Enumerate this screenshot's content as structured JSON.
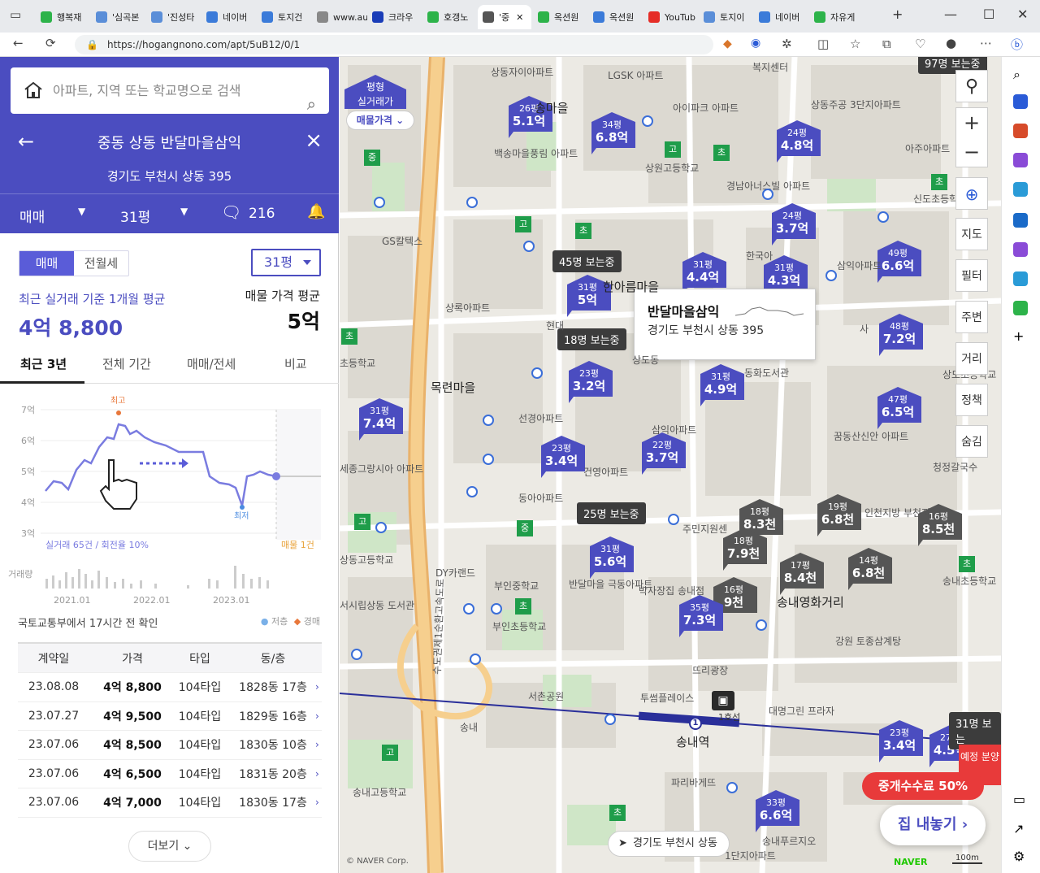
{
  "browser": {
    "tabs": [
      {
        "label": "행복재",
        "color": "#2db34a"
      },
      {
        "label": "'심곡본",
        "color": "#5a8ed8"
      },
      {
        "label": "'진성타",
        "color": "#5a8ed8"
      },
      {
        "label": "네이버",
        "color": "#3b7bd9"
      },
      {
        "label": "토지건",
        "color": "#3b7bd9"
      },
      {
        "label": "www.au",
        "color": "#888888"
      },
      {
        "label": "크라우",
        "color": "#1a3db8"
      },
      {
        "label": "호갱노",
        "color": "#2db34a"
      },
      {
        "label": "'중",
        "color": "#555555"
      },
      {
        "label": "옥션원",
        "color": "#2db34a"
      },
      {
        "label": "옥션원",
        "color": "#3b7bd9"
      },
      {
        "label": "YouTub",
        "color": "#e52d27"
      },
      {
        "label": "토지이",
        "color": "#5a8ed8"
      },
      {
        "label": "네이버",
        "color": "#3b7bd9"
      },
      {
        "label": "자유게",
        "color": "#2db34a"
      }
    ],
    "url": "https://hogangnono.com/apt/5uB12/0/1"
  },
  "panel": {
    "search_placeholder": "아파트, 지역 또는 학교명으로 검색",
    "title": "중동 상동 반달마을삼익",
    "address": "경기도 부천시 상동 395",
    "trade_type": "매매",
    "pyeong": "31평",
    "comments": "216",
    "trade_tab_sale": "매매",
    "trade_tab_rent": "전월세",
    "pyeong_select": "31평",
    "avg_label": "최근 실거래 기준 1개월 평균",
    "avg_value": "4억 8,800",
    "market_label": "매물 가격 평균",
    "market_value": "5억",
    "period_tabs": [
      "최근 3년",
      "전체 기간",
      "매매/전세",
      "비교"
    ],
    "chart": {
      "y_labels": [
        "7억",
        "6억",
        "5억",
        "4억",
        "3억"
      ],
      "high_label": "최고",
      "low_label": "최저",
      "stats": "실거래 65건 / 회전율 10%",
      "listing": "매물 1건",
      "volume_label": "거래량",
      "x_labels": [
        "2021.01",
        "2022.01",
        "2023.01"
      ]
    },
    "confirm_text": "국토교통부에서 17시간 전 확인",
    "legend_low": "저층",
    "legend_high": "경매",
    "table_headers": [
      "계약일",
      "가격",
      "타입",
      "동/층"
    ],
    "rows": [
      {
        "date": "23.08.08",
        "price": "4억 8,800",
        "type": "104타입",
        "floor": "1828동 17층"
      },
      {
        "date": "23.07.27",
        "price": "4억 9,500",
        "type": "104타입",
        "floor": "1829동 16층"
      },
      {
        "date": "23.07.06",
        "price": "4억 8,500",
        "type": "104타입",
        "floor": "1830동 10층"
      },
      {
        "date": "23.07.06",
        "price": "4억 6,500",
        "type": "104타입",
        "floor": "1831동 20층"
      },
      {
        "date": "23.07.06",
        "price": "4억 7,000",
        "type": "104타입",
        "floor": "1830동 17층"
      }
    ],
    "more": "더보기"
  },
  "map": {
    "filter_top": "평형",
    "filter_mid": "실거래가",
    "filter_btn": "매물가격",
    "markers": [
      {
        "p": "26평",
        "v": "5.1억",
        "color": "#4b4dc0"
      },
      {
        "p": "34평",
        "v": "6.8억",
        "color": "#4b4dc0"
      },
      {
        "p": "24평",
        "v": "4.8억",
        "color": "#4b4dc0"
      },
      {
        "p": "24평",
        "v": "3.7억",
        "color": "#4b4dc0"
      },
      {
        "p": "31평",
        "v": "4.4억",
        "color": "#4b4dc0"
      },
      {
        "p": "31평",
        "v": "4.3억",
        "color": "#4b4dc0"
      },
      {
        "p": "49평",
        "v": "6.6억",
        "color": "#4b4dc0"
      },
      {
        "p": "31평",
        "v": "5억",
        "color": "#4b4dc0"
      },
      {
        "p": "48평",
        "v": "7.2억",
        "color": "#4b4dc0"
      },
      {
        "p": "23평",
        "v": "3.2억",
        "color": "#4b4dc0"
      },
      {
        "p": "31평",
        "v": "4.9억",
        "color": "#4b4dc0"
      },
      {
        "p": "31평",
        "v": "7.4억",
        "color": "#4b4dc0"
      },
      {
        "p": "47평",
        "v": "6.5억",
        "color": "#4b4dc0"
      },
      {
        "p": "23평",
        "v": "3.4억",
        "color": "#4b4dc0"
      },
      {
        "p": "22평",
        "v": "3.7억",
        "color": "#4b4dc0"
      },
      {
        "p": "19평",
        "v": "6.8천",
        "color": "#555555"
      },
      {
        "p": "16평",
        "v": "8.5천",
        "color": "#555555"
      },
      {
        "p": "18평",
        "v": "8.3천",
        "color": "#555555"
      },
      {
        "p": "18평",
        "v": "7.9천",
        "color": "#555555"
      },
      {
        "p": "17평",
        "v": "8.4천",
        "color": "#555555"
      },
      {
        "p": "14평",
        "v": "6.8천",
        "color": "#555555"
      },
      {
        "p": "31평",
        "v": "5.6억",
        "color": "#4b4dc0"
      },
      {
        "p": "16평",
        "v": "9천",
        "color": "#555555"
      },
      {
        "p": "35평",
        "v": "7.3억",
        "color": "#4b4dc0"
      },
      {
        "p": "23평",
        "v": "3.4억",
        "color": "#4b4dc0"
      },
      {
        "p": "27평",
        "v": "4.5억",
        "color": "#4b4dc0"
      },
      {
        "p": "33평",
        "v": "6.6억",
        "color": "#4b4dc0"
      }
    ],
    "views_45": "45명 보는중",
    "views_18": "18명 보는중",
    "views_25": "25명 보는중",
    "views_31": "31명 보는",
    "views_97": "97명 보는중",
    "popup_name": "반달마을삼익",
    "popup_addr": "경기도 부천시 상동 395",
    "pois": [
      "상동자이아파트",
      "LGSK 아파트",
      "복지센터",
      "아이파크 아파트",
      "상동주공 3단지아파트",
      "아주아파트",
      "송마을",
      "백송마을풍림 아파트",
      "상원고등학교",
      "경남아너스빌 아파트",
      "신도초등학교",
      "GS칼텍스",
      "한국아",
      "삼익아파트",
      "상록아파트",
      "한아름마을",
      "사",
      "현대",
      "선경아파트",
      "목련마을",
      "상도동",
      "동화도서관",
      "상도초등학교",
      "초등학교",
      "삼익아파트",
      "꿈동산신안 아파트",
      "청정갈국수",
      "세종그랑시아 아파트",
      "건영아파트",
      "동아아파트",
      "인천지방 부천지",
      "주민지원센",
      "상동고등학교",
      "DY카랜드",
      "부인중학교",
      "반달마을 극동아파트",
      "박사장집 송내점",
      "송내영화거리",
      "송내초등학교",
      "서시립상동 도서관",
      "부인초등학교",
      "강원 토종삼계탕",
      "서촌공원",
      "투썸플레이스",
      "뜨리광장",
      "대명그린 프라자",
      "송내역",
      "파리바게뜨",
      "송내고등학교",
      "송내",
      "1단지아파트",
      "송내푸르지오"
    ],
    "highway": "수도권제1순환고속도로",
    "station": "송내역",
    "line_badge": "1호선",
    "controls": [
      "지도",
      "필터",
      "주변",
      "거리",
      "정책",
      "숨김"
    ],
    "promo": "중개수수료 50%",
    "list_btn": "집 내놓기",
    "loc_text": "경기도 부천시 상동",
    "sale_tag": "예정 분양",
    "naver": "NAVER",
    "scale": "100m",
    "copyright": "© NAVER Corp."
  }
}
